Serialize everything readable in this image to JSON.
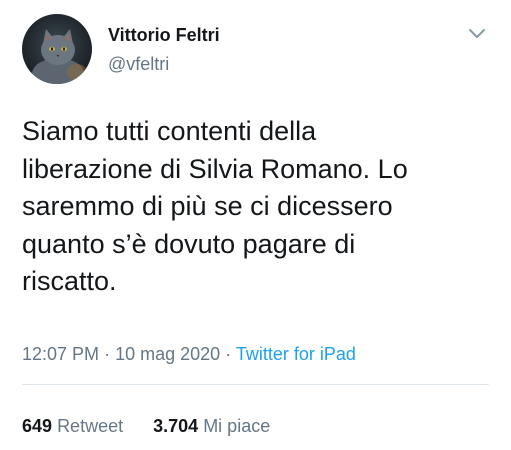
{
  "author": {
    "display_name": "Vittorio Feltri",
    "handle": "@vfeltri",
    "avatar_icon": "cat-avatar-icon"
  },
  "tweet": {
    "text": "Siamo tutti contenti della\nliberazione di Silvia Romano. Lo\nsaremmo di più se ci dicessero\nquanto s’è dovuto pagare di\nriscatto."
  },
  "meta": {
    "time": "12:07 PM",
    "separator": "·",
    "date": "10 mag 2020",
    "source": "Twitter for iPad"
  },
  "stats": {
    "retweets_count": "649",
    "retweets_label": "Retweet",
    "likes_count": "3.704",
    "likes_label": "Mi piace"
  },
  "icons": {
    "menu": "chevron-down-icon"
  },
  "colors": {
    "text": "#14171a",
    "secondary": "#657786",
    "link": "#1da1f2",
    "divider": "#e1e8ed"
  }
}
